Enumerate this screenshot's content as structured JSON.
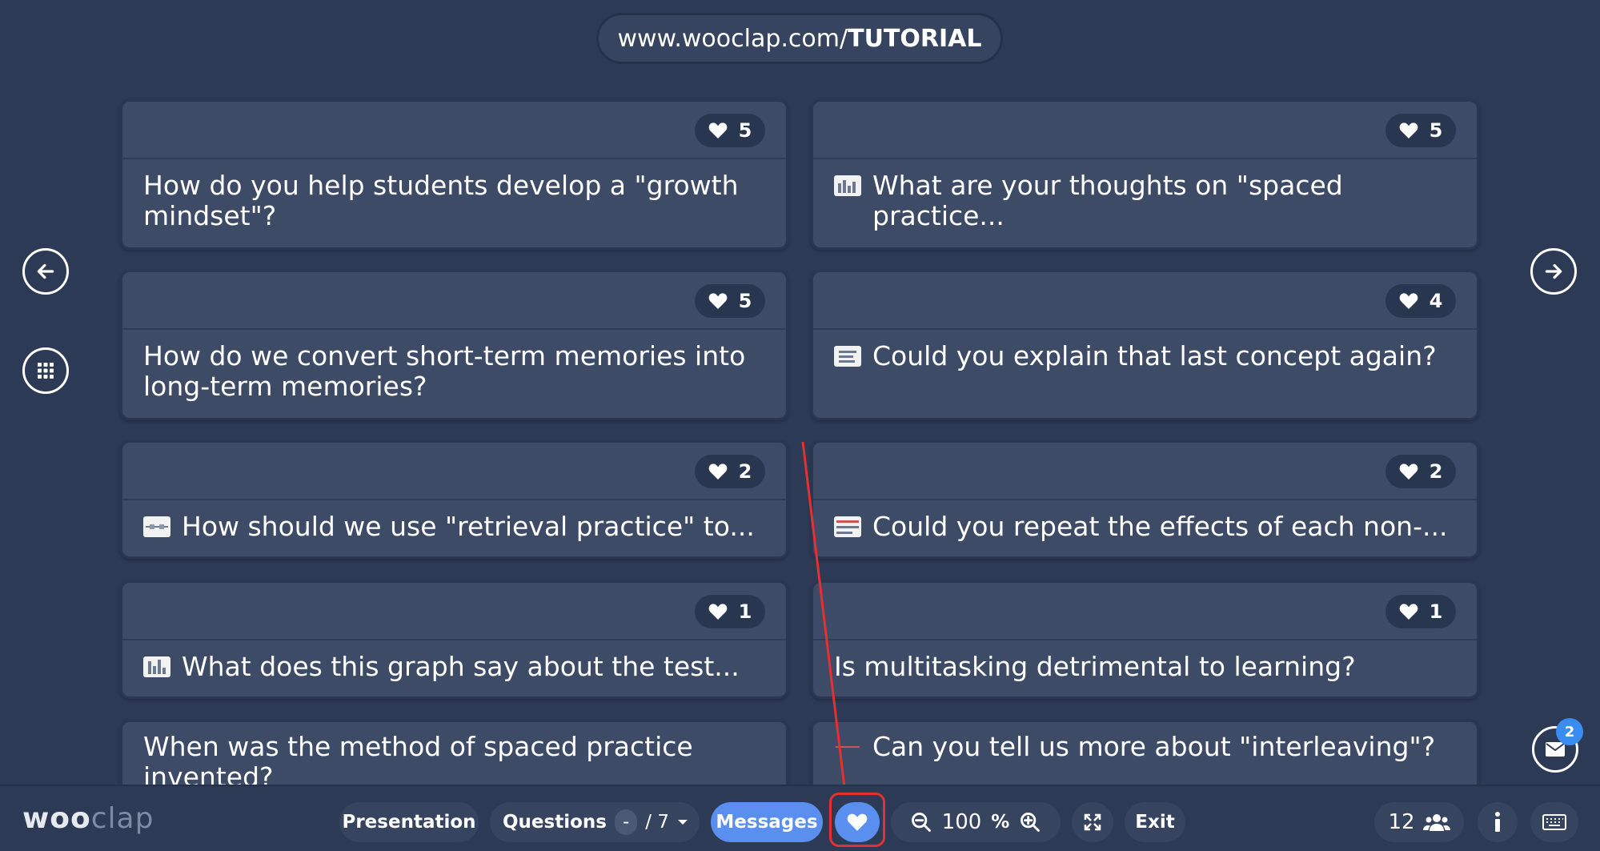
{
  "header": {
    "url_prefix": "www.wooclap.com/",
    "url_code": "TUTORIAL"
  },
  "cards": [
    {
      "likes": "5",
      "text": "How do you help students develop a \"growth mindset\"?",
      "has_thumb": false
    },
    {
      "likes": "5",
      "text": "What are your thoughts on \"spaced practice...",
      "has_thumb": true
    },
    {
      "likes": "5",
      "text": "How do we convert short-term memories into long-term memories?",
      "has_thumb": false
    },
    {
      "likes": "4",
      "text": "Could you explain that last concept again?",
      "has_thumb": true
    },
    {
      "likes": "2",
      "text": "How should we use \"retrieval practice\" to...",
      "has_thumb": true
    },
    {
      "likes": "2",
      "text": "Could you repeat the effects of each non-...",
      "has_thumb": true
    },
    {
      "likes": "1",
      "text": "What does this graph say about the test...",
      "has_thumb": true
    },
    {
      "likes": "1",
      "text": "Is multitasking detrimental to learning?",
      "has_thumb": false
    },
    {
      "likes": "",
      "text": "When was the method of spaced practice invented?",
      "has_thumb": false
    },
    {
      "likes": "",
      "text": "Can you tell us more about \"interleaving\"?",
      "has_thumb": true
    }
  ],
  "toolbar": {
    "logo_bold": "woo",
    "logo_light": "clap",
    "presentation": "Presentation",
    "questions": "Questions",
    "question_current": "-",
    "question_total": "/ 7",
    "messages": "Messages",
    "zoom_value": "100",
    "zoom_unit": "%",
    "exit": "Exit",
    "participants": "12"
  },
  "messages_badge": "2",
  "colors": {
    "background": "#2c3a55",
    "card": "#3d4b67",
    "accent": "#5a8ff0",
    "highlight": "#e53030"
  }
}
